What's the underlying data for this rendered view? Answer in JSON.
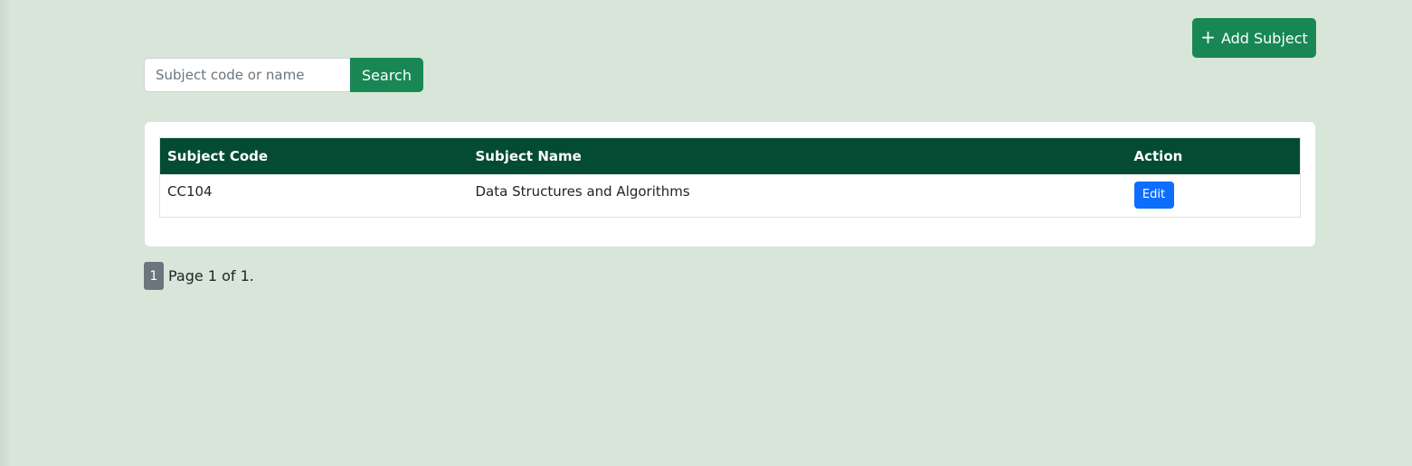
{
  "toolbar": {
    "add_subject_label": "Add Subject",
    "add_icon": "plus-icon"
  },
  "search": {
    "placeholder": "Subject code or name",
    "value": "",
    "button_label": "Search"
  },
  "table": {
    "headers": [
      "Subject Code",
      "Subject Name",
      "Action"
    ],
    "rows": [
      {
        "code": "CC104",
        "name": "Data Structures and Algorithms",
        "action": "Edit"
      }
    ]
  },
  "pagination": {
    "current_page": "1",
    "status_text": "Page 1 of 1."
  },
  "colors": {
    "background": "#d8e5d9",
    "primary_green": "#198754",
    "header_green": "#044b33",
    "edit_blue": "#0d6efd",
    "page_badge": "#6c757d"
  }
}
